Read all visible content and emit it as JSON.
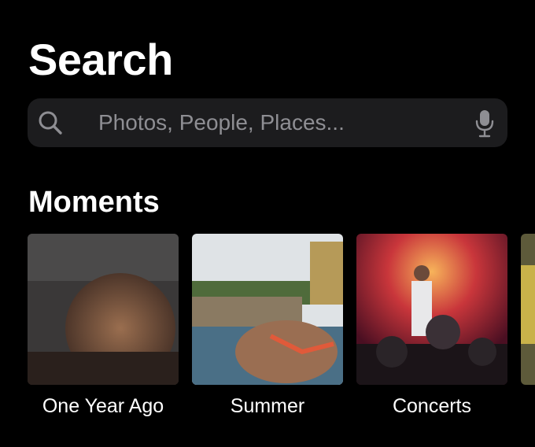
{
  "header": {
    "title": "Search"
  },
  "search": {
    "placeholder": "Photos, People, Places..."
  },
  "icons": {
    "search": "magnifying-glass-icon",
    "mic": "microphone-icon"
  },
  "moments": {
    "heading": "Moments",
    "items": [
      {
        "label": "One Year Ago",
        "thumbnail": "photo-thumbnail"
      },
      {
        "label": "Summer",
        "thumbnail": "photo-thumbnail"
      },
      {
        "label": "Concerts",
        "thumbnail": "photo-thumbnail"
      }
    ]
  },
  "colors": {
    "background": "#000000",
    "search_field": "#1c1c1e",
    "placeholder": "#8e8e93",
    "text": "#ffffff"
  }
}
